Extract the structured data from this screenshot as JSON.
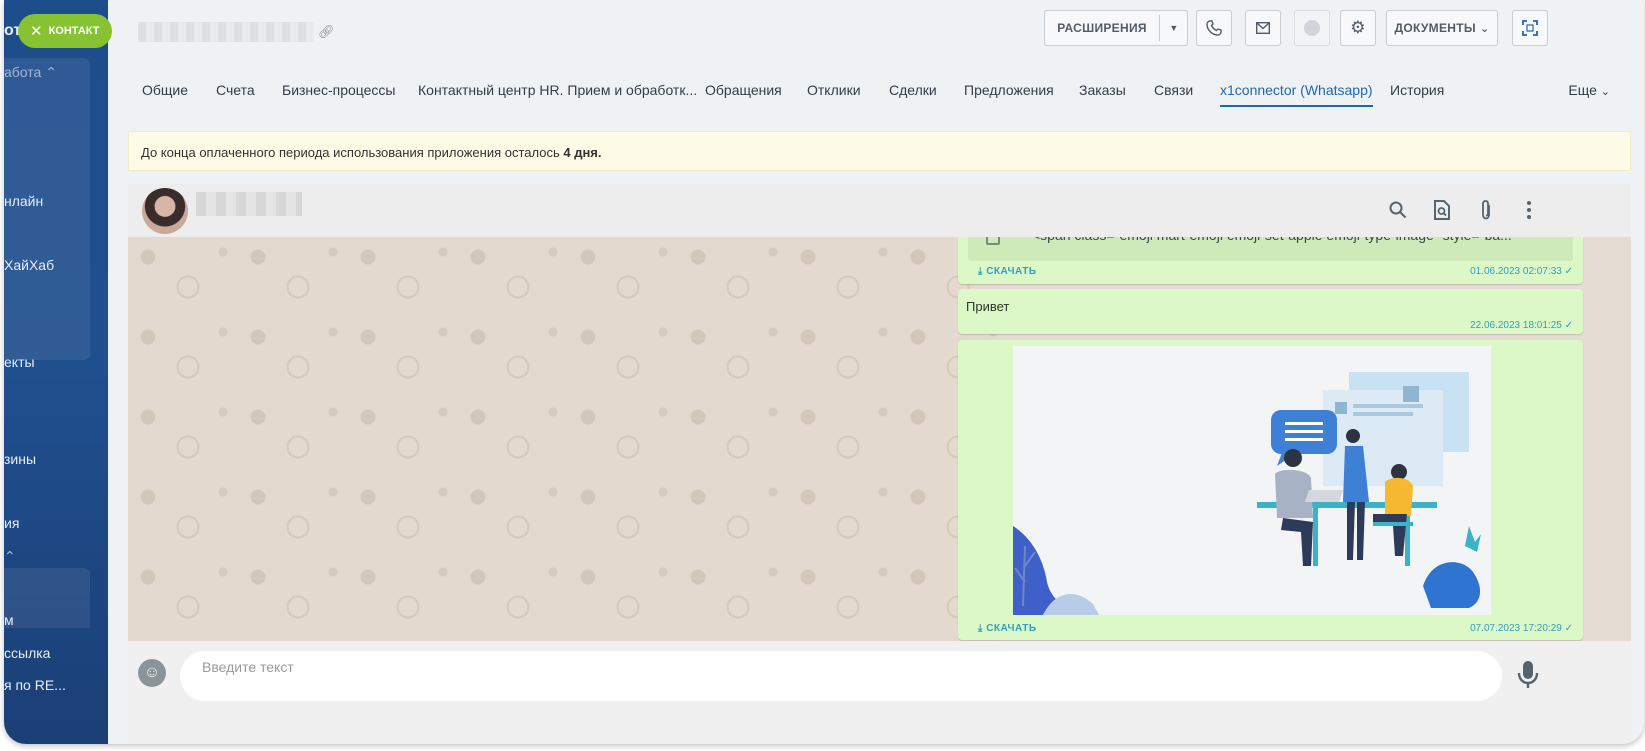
{
  "sidebar": {
    "contact_button": "КОНТАКТ",
    "items": [
      "абота",
      "нлайн",
      "ХайХаб",
      "екты",
      "зины",
      "ия",
      "м",
      "ссылка",
      "я по RE..."
    ]
  },
  "header": {
    "extensions_label": "РАСШИРЕНИЯ",
    "documents_label": "ДОКУМЕНТЫ"
  },
  "tabs": [
    "Общие",
    "Счета",
    "Бизнес-процессы",
    "Контактный центр HR. Прием и обработк...",
    "Обращения",
    "Отклики",
    "Сделки",
    "Предложения",
    "Заказы",
    "Связи",
    "x1connector (Whatsapp)",
    "История"
  ],
  "tab_more": "Еще",
  "active_tab": "x1connector (Whatsapp)",
  "notice": {
    "text": "До конца оплаченного периода использования приложения осталось ",
    "bold": "4 дня."
  },
  "messages": [
    {
      "type": "file",
      "file_name": "<span class=\"emoji mart-emoji emoji-set-apple emoji-type-image\" style=\"ba...",
      "download_label": "СКАЧАТЬ",
      "timestamp": "01.06.2023 02:07:33"
    },
    {
      "type": "text",
      "text": "Привет",
      "timestamp": "22.06.2023 18:01:25"
    },
    {
      "type": "image",
      "download_label": "СКАЧАТЬ",
      "timestamp": "07.07.2023 17:20:29"
    }
  ],
  "composer": {
    "placeholder": "Введите текст"
  },
  "colors": {
    "accent": "#2067b0",
    "bubble": "#dcf8c6",
    "contact_button": "#86c232",
    "sidebar": "#1e4d8c"
  }
}
